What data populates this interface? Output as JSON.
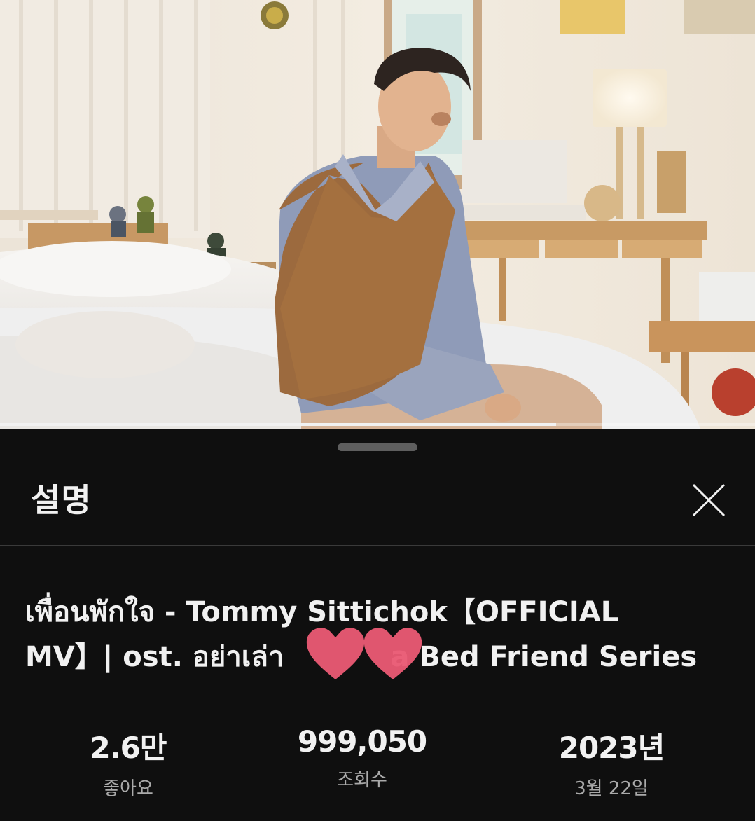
{
  "player": {
    "progress_fraction": 0.737
  },
  "sheet": {
    "title": "설명",
    "close_icon": "close-icon"
  },
  "video": {
    "title_line1": "เพื่อนพักใจ - Tommy Sittichok【OFFICIAL",
    "title_line2": "MV】| ost. อย่าเล่า",
    "title_line2_end": "a Bed Friend Series"
  },
  "stats": {
    "likes_value": "2.6만",
    "likes_label": "좋아요",
    "views_value": "999,050",
    "views_label": "조회수",
    "year_value": "2023년",
    "date_label": "3월 22일"
  },
  "colors": {
    "background": "#0f0f0f",
    "text_primary": "#f1f1f1",
    "text_secondary": "#aaaaaa",
    "heart": "#e95a74"
  }
}
